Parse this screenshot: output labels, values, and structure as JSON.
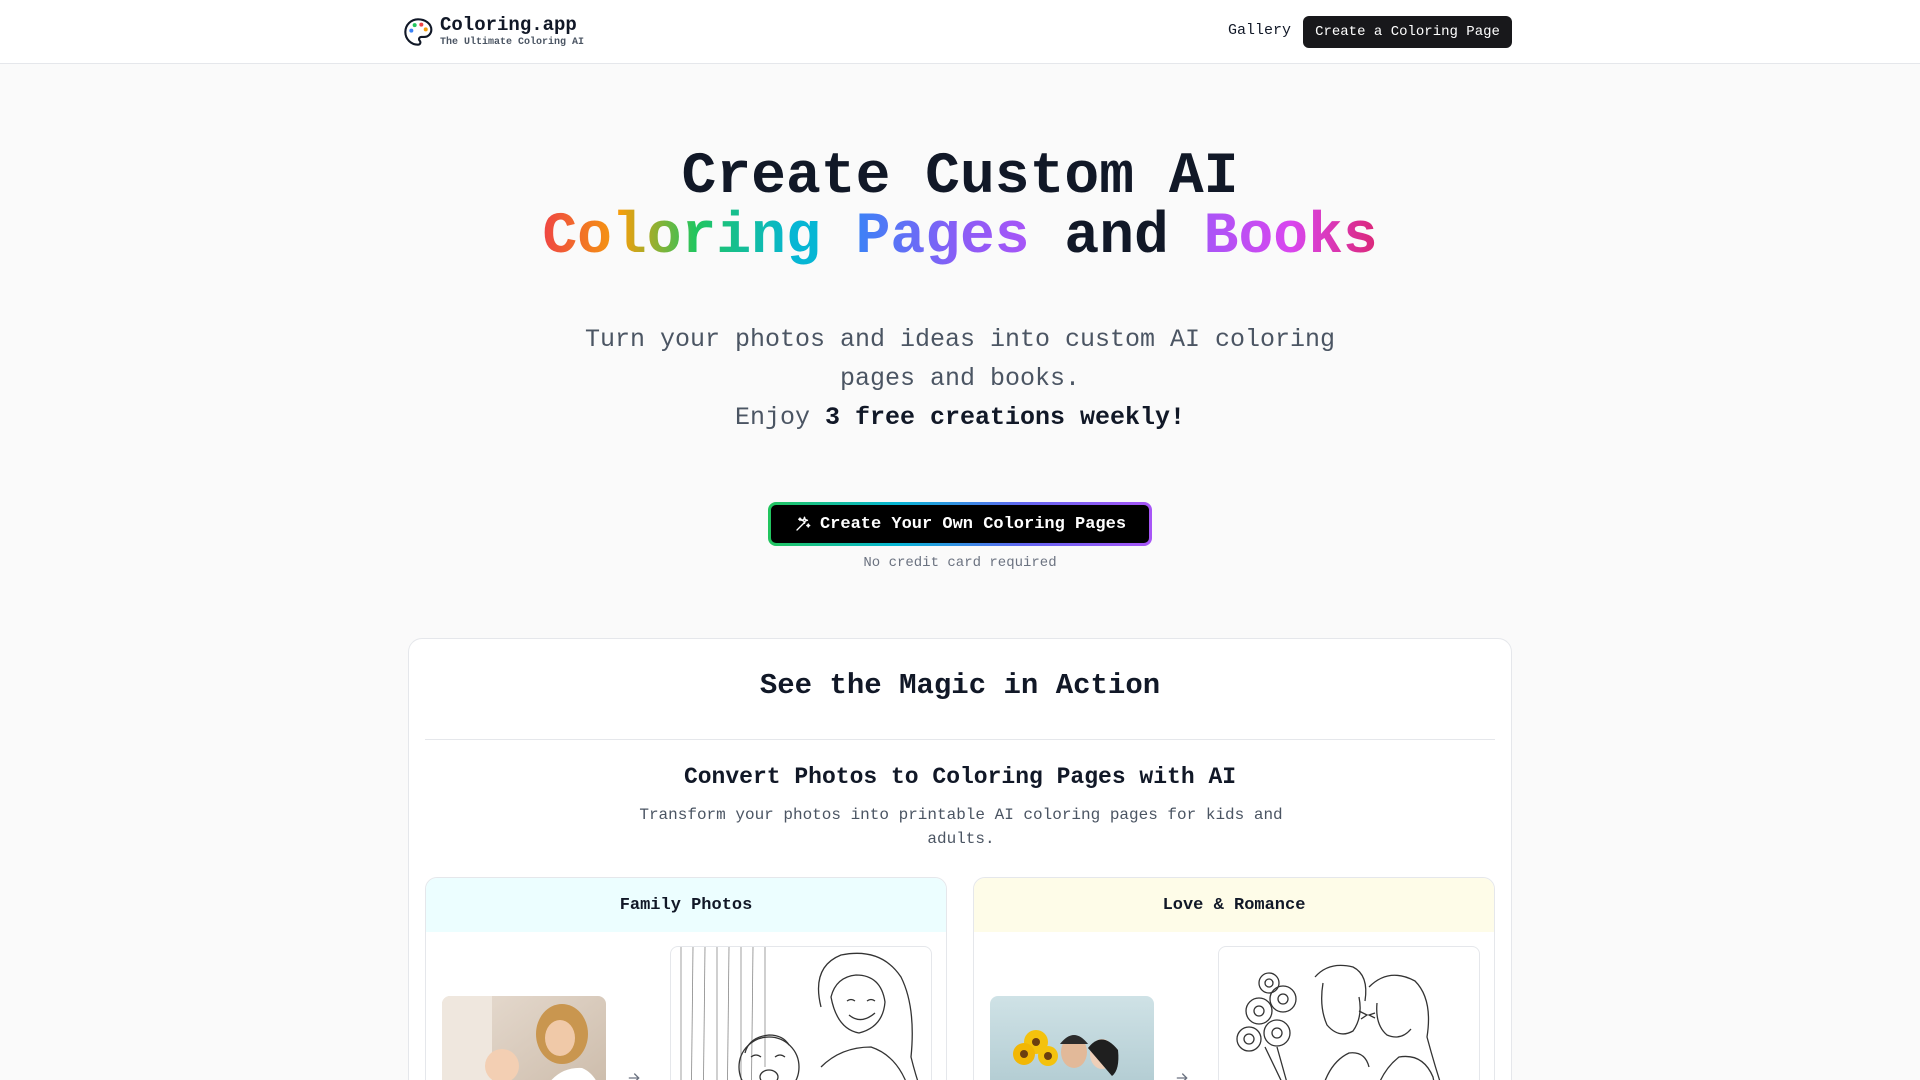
{
  "header": {
    "logo_title": "Coloring.app",
    "logo_subtitle": "The Ultimate Coloring AI",
    "nav_gallery": "Gallery",
    "nav_create": "Create a Coloring Page",
    "icons": {
      "logo": "palette-icon"
    }
  },
  "hero": {
    "title_line1": "Create Custom AI",
    "title_word_coloring": "Coloring",
    "title_word_pages": "Pages",
    "title_word_and": "and",
    "title_word_books": "Books",
    "subtitle": "Turn your photos and ideas into custom AI coloring pages and books.",
    "enjoy_prefix": "Enjoy",
    "enjoy_bold": "3 free creations weekly!",
    "cta_label": "Create Your Own Coloring Pages",
    "cta_icon": "sparkles-icon",
    "cta_note": "No credit card required"
  },
  "magic": {
    "title": "See the Magic in Action",
    "convert_title": "Convert Photos to Coloring Pages with AI",
    "convert_desc": "Transform your photos into printable AI coloring pages for kids and adults.",
    "examples": [
      {
        "label": "Family Photos",
        "arrow_icon": "arrow-right-icon"
      },
      {
        "label": "Love & Romance",
        "arrow_icon": "arrow-right-icon"
      }
    ]
  },
  "colors": {
    "brand_dark": "#18181b",
    "family_header_bg": "#ecfeff",
    "love_header_bg": "#fefce8"
  }
}
